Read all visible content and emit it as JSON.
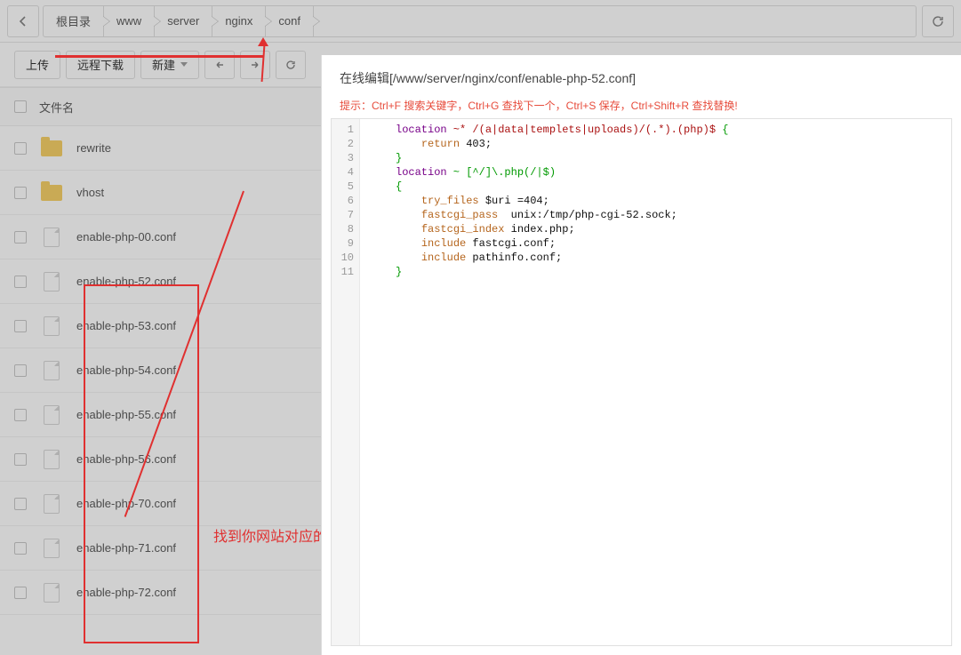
{
  "breadcrumbs": [
    "根目录",
    "www",
    "server",
    "nginx",
    "conf"
  ],
  "toolbar": {
    "upload": "上传",
    "download": "远程下载",
    "new": "新建"
  },
  "table": {
    "header_name": "文件名"
  },
  "files": [
    {
      "name": "rewrite",
      "type": "folder"
    },
    {
      "name": "vhost",
      "type": "folder"
    },
    {
      "name": "enable-php-00.conf",
      "type": "file"
    },
    {
      "name": "enable-php-52.conf",
      "type": "file"
    },
    {
      "name": "enable-php-53.conf",
      "type": "file"
    },
    {
      "name": "enable-php-54.conf",
      "type": "file"
    },
    {
      "name": "enable-php-55.conf",
      "type": "file"
    },
    {
      "name": "enable-php-56.conf",
      "type": "file"
    },
    {
      "name": "enable-php-70.conf",
      "type": "file"
    },
    {
      "name": "enable-php-71.conf",
      "type": "file"
    },
    {
      "name": "enable-php-72.conf",
      "type": "file"
    }
  ],
  "editor": {
    "title": "在线编辑[/www/server/nginx/conf/enable-php-52.conf]",
    "hint": "提示：Ctrl+F 搜索关键字，Ctrl+G 查找下一个，Ctrl+S 保存，Ctrl+Shift+R 查找替换!",
    "lines": [
      "1",
      "2",
      "3",
      "4",
      "5",
      "6",
      "7",
      "8",
      "9",
      "10",
      "11"
    ],
    "code": {
      "l1a": "location",
      "l1b": " ~* /(a|data|templets|uploads)/(.*).(php)$ ",
      "l1c": "{",
      "l2a": "return",
      "l2b": " 403;",
      "l3a": "}",
      "l4a": "location",
      "l4b": " ~ [^/]\\.php(/|$)",
      "l5a": "{",
      "l6a": "try_files",
      "l6b": " $uri =404;",
      "l7a": "fastcgi_pass",
      "l7b": "  unix:/tmp/php-cgi-52.sock;",
      "l8a": "fastcgi_index",
      "l8b": " index.php;",
      "l9a": "include",
      "l9b": " fastcgi.conf;",
      "l10a": "include",
      "l10b": " pathinfo.conf;",
      "l11a": "}"
    }
  },
  "annotation": "找到你网站对应的PHP版本，加在里面的前面"
}
